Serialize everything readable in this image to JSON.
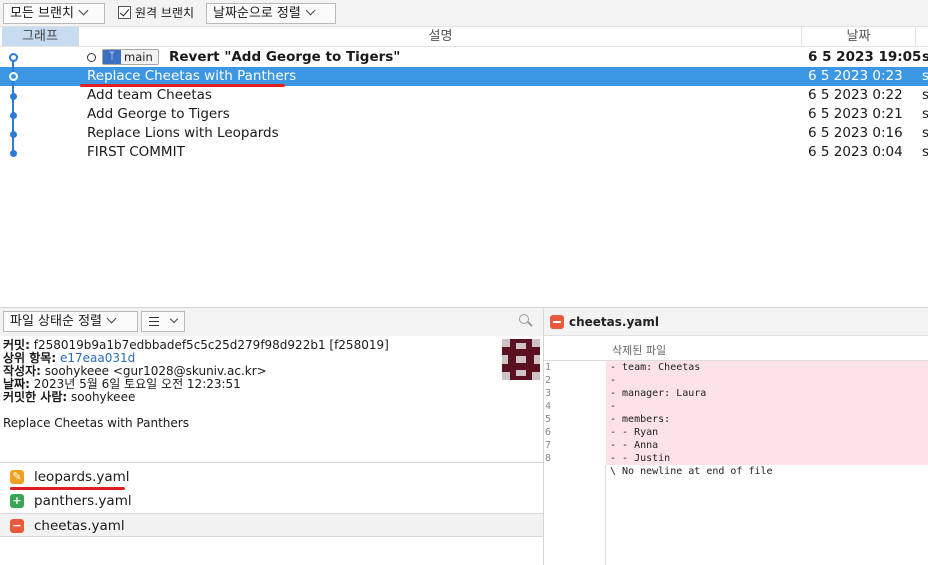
{
  "toolbar": {
    "branches_filter": "모든 브랜치",
    "remote_branches_label": "원격 브랜치",
    "remote_branches_checked": true,
    "sort": "날짜순으로 정렬"
  },
  "history": {
    "columns": {
      "graph": "그래프",
      "description": "설명",
      "date": "날짜"
    },
    "commits": [
      {
        "description": "Revert \"Add George to Tigers\"",
        "date": "6 5 2023 19:05",
        "author_initial": "s",
        "branch": "main",
        "bold": true
      },
      {
        "description": "Replace Cheetas with Panthers",
        "date": "6 5 2023 0:23",
        "author_initial": "s",
        "selected": true
      },
      {
        "description": "Add team Cheetas",
        "date": "6 5 2023 0:22",
        "author_initial": "s"
      },
      {
        "description": "Add George to Tigers",
        "date": "6 5 2023 0:21",
        "author_initial": "s"
      },
      {
        "description": "Replace Lions with Leopards",
        "date": "6 5 2023 0:16",
        "author_initial": "s"
      },
      {
        "description": "FIRST COMMIT",
        "date": "6 5 2023 0:04",
        "author_initial": "s"
      }
    ]
  },
  "details": {
    "file_sort": "파일 상태순 정렬",
    "commit_label": "커밋:",
    "commit_value": "f258019b9a1b7edbbadef5c5c25d279f98d922b1 [f258019]",
    "parent_label": "상위 항목:",
    "parent_value": "e17eaa031d",
    "author_label": "작성자:",
    "author_value": "soohykeee <gur1028@skuniv.ac.kr>",
    "date_label": "날짜:",
    "date_value": "2023년 5월 6일 토요일 오전 12:23:51",
    "committer_label": "커밋한 사람:",
    "committer_value": "soohykeee",
    "message": "Replace Cheetas with Panthers"
  },
  "files": [
    {
      "name": "leopards.yaml",
      "status": "modified",
      "status_color": "#f0a020",
      "icon": "pencil-icon"
    },
    {
      "name": "panthers.yaml",
      "status": "added",
      "status_color": "#3aa655",
      "icon": "plus-icon"
    },
    {
      "name": "cheetas.yaml",
      "status": "removed",
      "status_color": "#e95a3c",
      "icon": "minus-icon",
      "selected": true
    }
  ],
  "diff": {
    "file_name": "cheetas.yaml",
    "header": "삭제된 파일",
    "lines": [
      {
        "num": "1",
        "text": "- team: Cheetas",
        "type": "del"
      },
      {
        "num": "2",
        "text": "-",
        "type": "del"
      },
      {
        "num": "3",
        "text": "- manager: Laura",
        "type": "del"
      },
      {
        "num": "4",
        "text": "-",
        "type": "del"
      },
      {
        "num": "5",
        "text": "- members:",
        "type": "del"
      },
      {
        "num": "6",
        "text": "- - Ryan",
        "type": "del"
      },
      {
        "num": "7",
        "text": "- - Anna",
        "type": "del"
      },
      {
        "num": "8",
        "text": "- - Justin",
        "type": "del"
      },
      {
        "num": "",
        "text": "\\ No newline at end of file",
        "type": "ctx"
      }
    ]
  },
  "colors": {
    "selection": "#3b97e3",
    "graph": "#2e7bd6",
    "annotation": "#e02020",
    "deleted_bg": "#fde3e6"
  }
}
